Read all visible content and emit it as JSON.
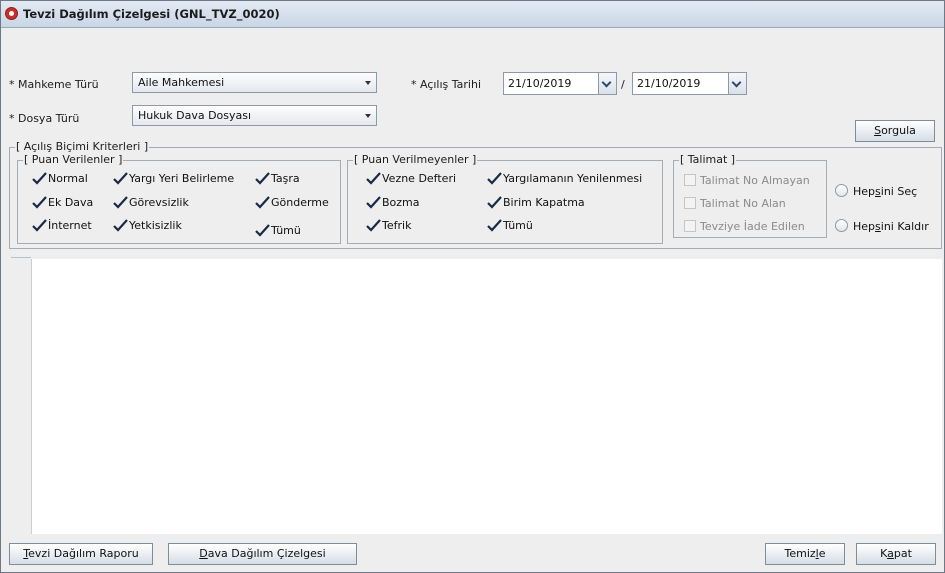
{
  "window": {
    "title": "Tevzi Dağılım Çizelgesi (GNL_TVZ_0020)"
  },
  "form": {
    "mahkeme_label": "* Mahkeme Türü",
    "mahkeme_value": "Aile Mahkemesi",
    "dosya_label": "* Dosya Türü",
    "dosya_value": "Hukuk Dava Dosyası",
    "acilis_label": "* Açılış Tarihi",
    "date_from": "21/10/2019",
    "date_sep": "/",
    "date_to": "21/10/2019"
  },
  "sorgula": {
    "pre": "",
    "ul": "S",
    "post": "orgula"
  },
  "criteria": {
    "title": "[ Açılış Biçimi Kriterleri ]",
    "puan_verilenler": {
      "title": "[ Puan Verilenler ]",
      "items": [
        {
          "label": "Normal",
          "checked": true
        },
        {
          "label": "Ek Dava",
          "checked": true
        },
        {
          "label": "İnternet",
          "checked": true
        },
        {
          "label": "Yargı Yeri Belirleme",
          "checked": true
        },
        {
          "label": "Görevsizlik",
          "checked": true
        },
        {
          "label": "Yetkisizlik",
          "checked": true
        },
        {
          "label": "Taşra",
          "checked": true
        },
        {
          "label": "Gönderme",
          "checked": true
        },
        {
          "label": "Tümü",
          "checked": true
        }
      ]
    },
    "puan_verilmeyenler": {
      "title": "[ Puan Verilmeyenler ]",
      "items": [
        {
          "label": "Vezne Defteri",
          "checked": true
        },
        {
          "label": "Bozma",
          "checked": true
        },
        {
          "label": "Tefrik",
          "checked": true
        },
        {
          "label": "Yargılamanın Yenilenmesi",
          "checked": true
        },
        {
          "label": "Birim Kapatma",
          "checked": true
        },
        {
          "label": "Tümü",
          "checked": true
        }
      ]
    },
    "talimat": {
      "title": "[ Talimat ]",
      "items": [
        {
          "label": "Talimat No Almayan",
          "checked": false,
          "enabled": false
        },
        {
          "label": "Talimat No Alan",
          "checked": false,
          "enabled": false
        },
        {
          "label": "Tevziye İade Edilen",
          "checked": false,
          "enabled": false
        }
      ]
    },
    "hepsini_sec": {
      "pre": "Hep",
      "ul": "s",
      "post": "ini Seç"
    },
    "hepsini_kaldir": {
      "pre": "Hep",
      "ul": "s",
      "post": "ini Kaldır"
    }
  },
  "footer": {
    "tevzi_raporu": {
      "pre": "",
      "ul": "T",
      "post": "evzi Dağılım Raporu"
    },
    "dava_cizelgesi": {
      "pre": "",
      "ul": "D",
      "post": "ava Dağılım Çizelgesi"
    },
    "temizle": {
      "pre": "Temiz",
      "ul": "l",
      "post": "e"
    },
    "kapat": {
      "pre": "K",
      "ul": "a",
      "post": "pat"
    }
  },
  "colors": {
    "checkmark": "#1a2a44",
    "title_gradient_top": "#e3eaf3",
    "title_gradient_bottom": "#c9d6e6"
  }
}
